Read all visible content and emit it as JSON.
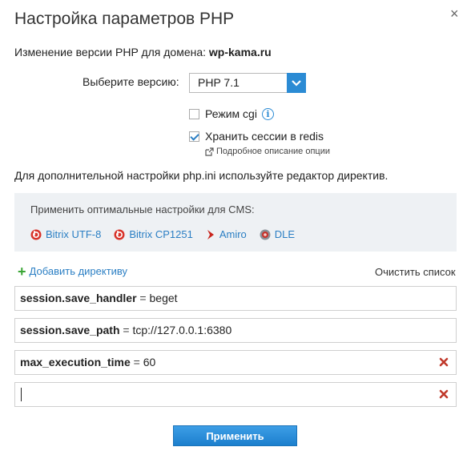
{
  "dialog": {
    "title": "Настройка параметров PHP",
    "close_label": "×"
  },
  "domain": {
    "label": "Изменение версии PHP для домена:",
    "name": "wp-kama.ru"
  },
  "version": {
    "label": "Выберите версию:",
    "selected": "PHP 7.1"
  },
  "options": {
    "cgi_label": "Режим cgi",
    "cgi_checked": false,
    "redis_label": "Хранить сессии в redis",
    "redis_checked": true,
    "desc_link": "Подробное описание опции"
  },
  "note": "Для дополнительной настройки php.ini используйте редактор директив.",
  "cms": {
    "title": "Применить оптимальные настройки для CMS:",
    "links": [
      {
        "label": "Bitrix UTF-8",
        "icon": "bitrix-icon"
      },
      {
        "label": "Bitrix CP1251",
        "icon": "bitrix-icon"
      },
      {
        "label": "Amiro",
        "icon": "amiro-icon"
      },
      {
        "label": "DLE",
        "icon": "dle-icon"
      }
    ]
  },
  "directives": {
    "add_label": "Добавить директиву",
    "clear_label": "Очистить список",
    "items": [
      {
        "key": "session.save_handler",
        "eq": " = ",
        "value": "beget"
      },
      {
        "key": "session.save_path",
        "eq": " = ",
        "value": "tcp://127.0.0.1:6380"
      },
      {
        "key": "max_execution_time",
        "eq": " = ",
        "value": "60"
      }
    ]
  },
  "apply_label": "Применить",
  "colors": {
    "accent": "#2b8bd4",
    "link": "#2b7fc4",
    "delete": "#c0392b",
    "add": "#3aa535",
    "cms_bg": "#eef1f4"
  }
}
